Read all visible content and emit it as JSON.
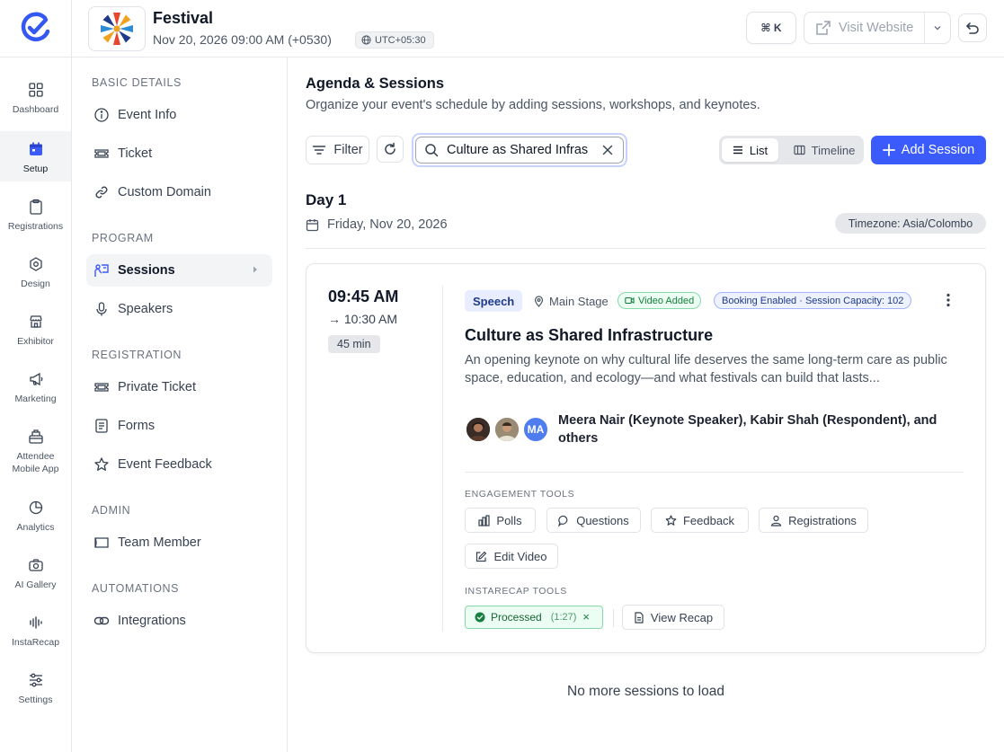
{
  "header": {
    "event_name": "Festival",
    "event_datetime": "Nov 20, 2026 09:00 AM (+0530)",
    "timezone_badge": "UTC+05:30",
    "shortcut_label": "⌘ K",
    "visit_website_label": "Visit Website",
    "icons": [
      "logo-icon",
      "globe-icon",
      "external-link-icon",
      "chevron-down-icon",
      "undo-icon"
    ]
  },
  "rail": {
    "items": [
      {
        "label": "Dashboard",
        "icon": "grid-icon"
      },
      {
        "label": "Setup",
        "icon": "calendar-icon",
        "active": true
      },
      {
        "label": "Registrations",
        "icon": "clipboard-icon"
      },
      {
        "label": "Design",
        "icon": "palette-icon"
      },
      {
        "label": "Exhibitor",
        "icon": "store-icon"
      },
      {
        "label": "Marketing",
        "icon": "megaphone-icon"
      },
      {
        "label": "Attendee Mobile App",
        "icon": "app-icon"
      },
      {
        "label": "Analytics",
        "icon": "pie-chart-icon"
      },
      {
        "label": "AI Gallery",
        "icon": "camera-icon"
      },
      {
        "label": "InstaRecap",
        "icon": "audio-wave-icon"
      },
      {
        "label": "Settings",
        "icon": "sliders-icon"
      }
    ]
  },
  "sidebar": {
    "sections": [
      {
        "title": "BASIC DETAILS",
        "items": [
          "Event Info",
          "Ticket",
          "Custom Domain"
        ]
      },
      {
        "title": "PROGRAM",
        "items": [
          "Sessions",
          "Speakers"
        ]
      },
      {
        "title": "REGISTRATION",
        "items": [
          "Private Ticket",
          "Forms",
          "Event Feedback"
        ]
      },
      {
        "title": "ADMIN",
        "items": [
          "Team Member"
        ]
      },
      {
        "title": "AUTOMATIONS",
        "items": [
          "Integrations"
        ]
      }
    ],
    "active_item": "Sessions"
  },
  "main": {
    "title": "Agenda & Sessions",
    "subtitle": "Organize your event's schedule by adding sessions, workshops, and keynotes.",
    "filter_label": "Filter",
    "search_value": "Culture as Shared Infras",
    "view_list_label": "List",
    "view_timeline_label": "Timeline",
    "active_view": "List",
    "add_session_label": "Add Session",
    "day": {
      "title": "Day 1",
      "date": "Friday, Nov 20, 2026",
      "timezone": "Timezone: Asia/Colombo"
    },
    "session": {
      "start_time": "09:45 AM",
      "end_time": "→ 10:30 AM",
      "duration": "45 min",
      "type": "Speech",
      "location": "Main Stage",
      "video_badge": "Video Added",
      "booking_badge": "Booking Enabled · Session Capacity: 102",
      "title": "Culture as Shared Infrastructure",
      "description": "An opening keynote on why cultural life deserves the same long-term care as public space, education, and ecology—and what festivals can build that lasts...",
      "avatar_initials": "MA",
      "speakers": "Meera Nair (Keynote Speaker), Kabir Shah (Respondent), and others",
      "engagement_label": "ENGAGEMENT TOOLS",
      "engagement_tools": [
        "Polls",
        "Questions",
        "Feedback",
        "Registrations"
      ],
      "edit_video_label": "Edit Video",
      "instarecap_label": "INSTARECAP TOOLS",
      "processed_label": "Processed",
      "processed_duration": "(1:27)",
      "processed_clear": "×",
      "view_recap_label": "View Recap"
    },
    "footer_text": "No more sessions to load"
  },
  "colors": {
    "primary": "#3b5bfd",
    "success": "#15803d",
    "active_bg": "#f3f4f6"
  }
}
